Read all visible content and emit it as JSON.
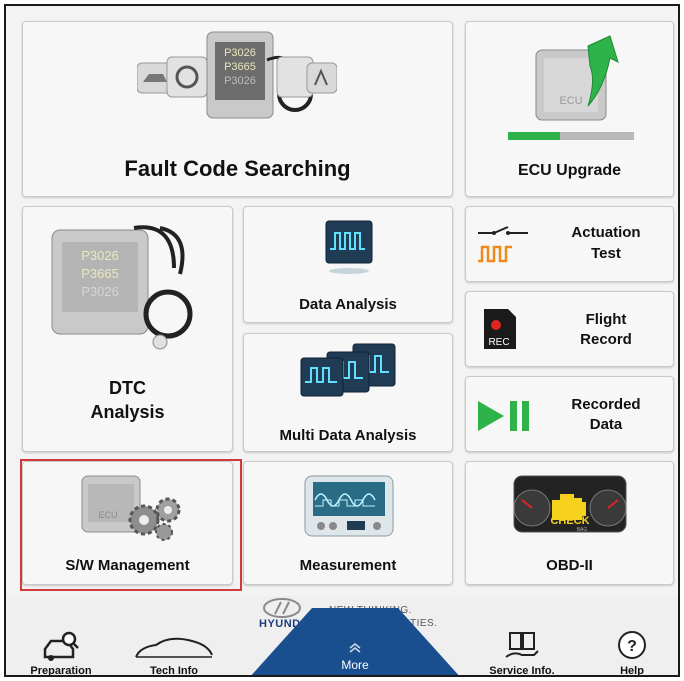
{
  "tiles": {
    "fault_code": "Fault Code Searching",
    "ecu_upgrade": "ECU Upgrade",
    "dtc": [
      "DTC",
      "Analysis"
    ],
    "data_analysis": "Data Analysis",
    "multi_data": "Multi Data Analysis",
    "actuation": [
      "Actuation",
      "Test"
    ],
    "flight": [
      "Flight",
      "Record"
    ],
    "recorded": [
      "Recorded",
      "Data"
    ],
    "sw_management": "S/W Management",
    "measurement": "Measurement",
    "obd": "OBD-II"
  },
  "icon_text": {
    "dtc_codes": [
      "P3026",
      "P3665",
      "P3026"
    ],
    "ecu": "ECU",
    "rec": "REC",
    "check": "CHECK",
    "bag": "BAG"
  },
  "brand": {
    "name": "HYUNDAI",
    "slogan": [
      "NEW THINKING.",
      "NEW POSSIBILITIES."
    ]
  },
  "nav": {
    "preparation": "Preparation",
    "tech_info": "Tech Info",
    "more": "More",
    "service_info": "Service Info.",
    "help": "Help"
  },
  "colors": {
    "highlight": "#d23a3a",
    "more_tab": "#1a4f8f",
    "accent_green": "#2db34a"
  },
  "icons": [
    "ecu-stethoscope-icon",
    "ecu-upgrade-icon",
    "oscilloscope-icon",
    "actuation-icon",
    "rec-icon",
    "play-pause-icon",
    "ecu-gears-icon",
    "measurement-icon",
    "check-engine-icon",
    "car-search-icon",
    "car-icon",
    "chevron-up-icon",
    "book-hand-icon",
    "help-icon"
  ]
}
